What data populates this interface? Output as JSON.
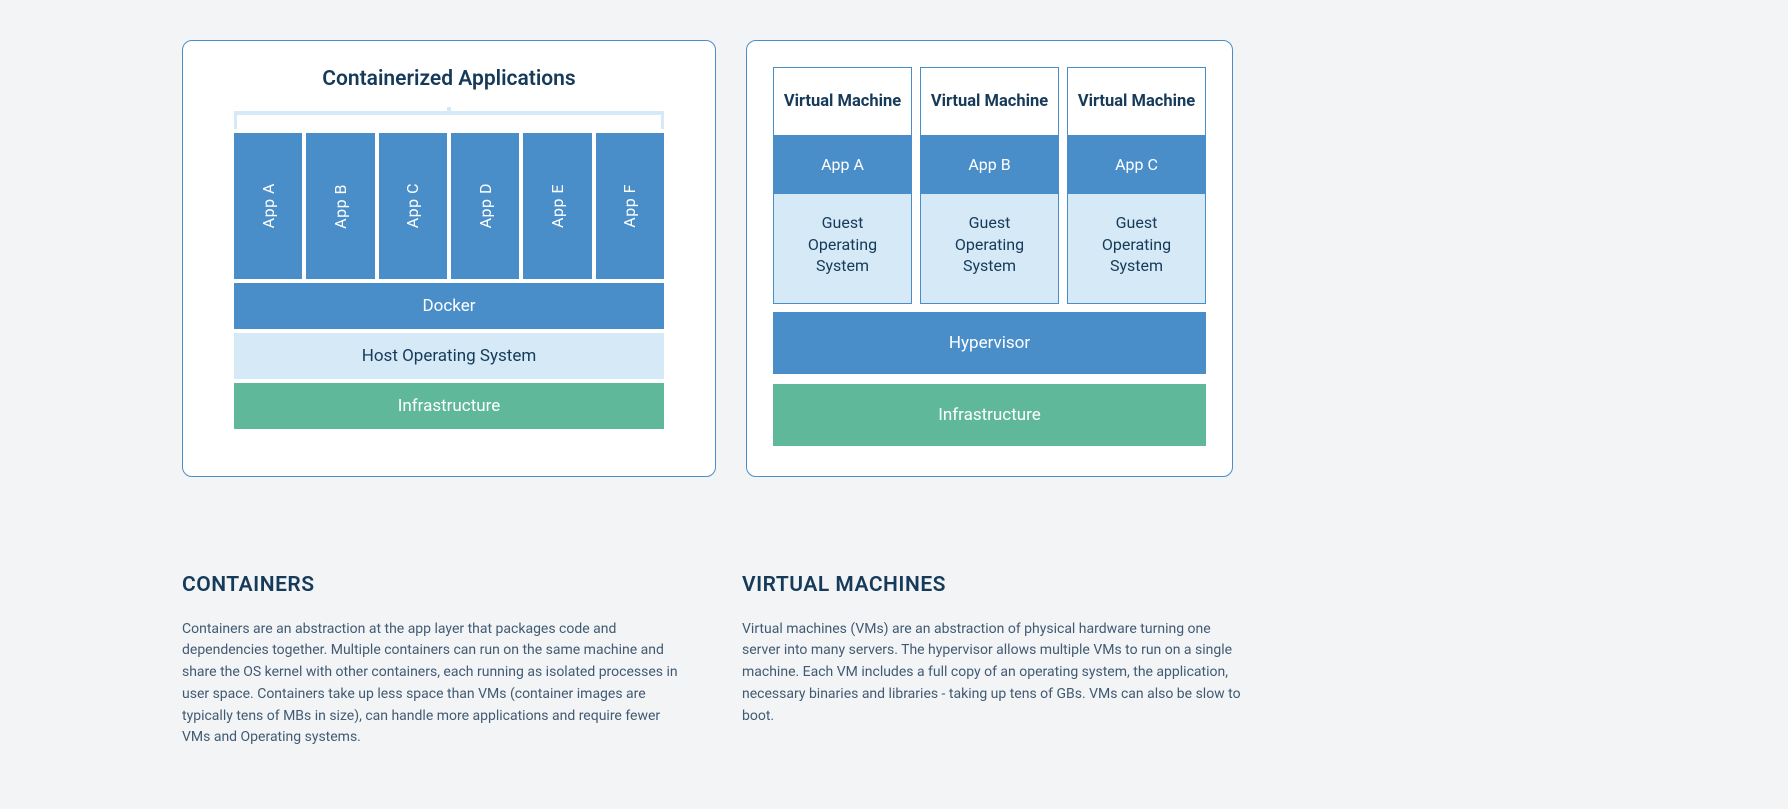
{
  "containers_diagram": {
    "title": "Containerized Applications",
    "apps": [
      "App A",
      "App B",
      "App C",
      "App D",
      "App E",
      "App F"
    ],
    "docker": "Docker",
    "host_os": "Host Operating System",
    "infrastructure": "Infrastructure"
  },
  "vm_diagram": {
    "vms": [
      {
        "title": "Virtual Machine",
        "app": "App A",
        "guest1": "Guest",
        "guest2": "Operating",
        "guest3": "System"
      },
      {
        "title": "Virtual Machine",
        "app": "App B",
        "guest1": "Guest",
        "guest2": "Operating",
        "guest3": "System"
      },
      {
        "title": "Virtual Machine",
        "app": "App C",
        "guest1": "Guest",
        "guest2": "Operating",
        "guest3": "System"
      }
    ],
    "hypervisor": "Hypervisor",
    "infrastructure": "Infrastructure"
  },
  "text": {
    "containers": {
      "heading": "CONTAINERS",
      "body": "Containers are an abstraction at the app layer that packages code and dependencies together. Multiple containers can run on the same machine and share the OS kernel with other containers, each running as isolated processes in user space. Containers take up less space than VMs (container images are typically tens of MBs in size), can handle more applications and require fewer VMs and Operating systems."
    },
    "vms": {
      "heading": "VIRTUAL MACHINES",
      "body": "Virtual machines (VMs) are an abstraction of physical hardware turning one server into many servers. The hypervisor allows multiple VMs to run on a single machine. Each VM includes a full copy of an operating system, the application, necessary binaries and libraries - taking up tens of GBs. VMs can also be slow to boot."
    }
  }
}
